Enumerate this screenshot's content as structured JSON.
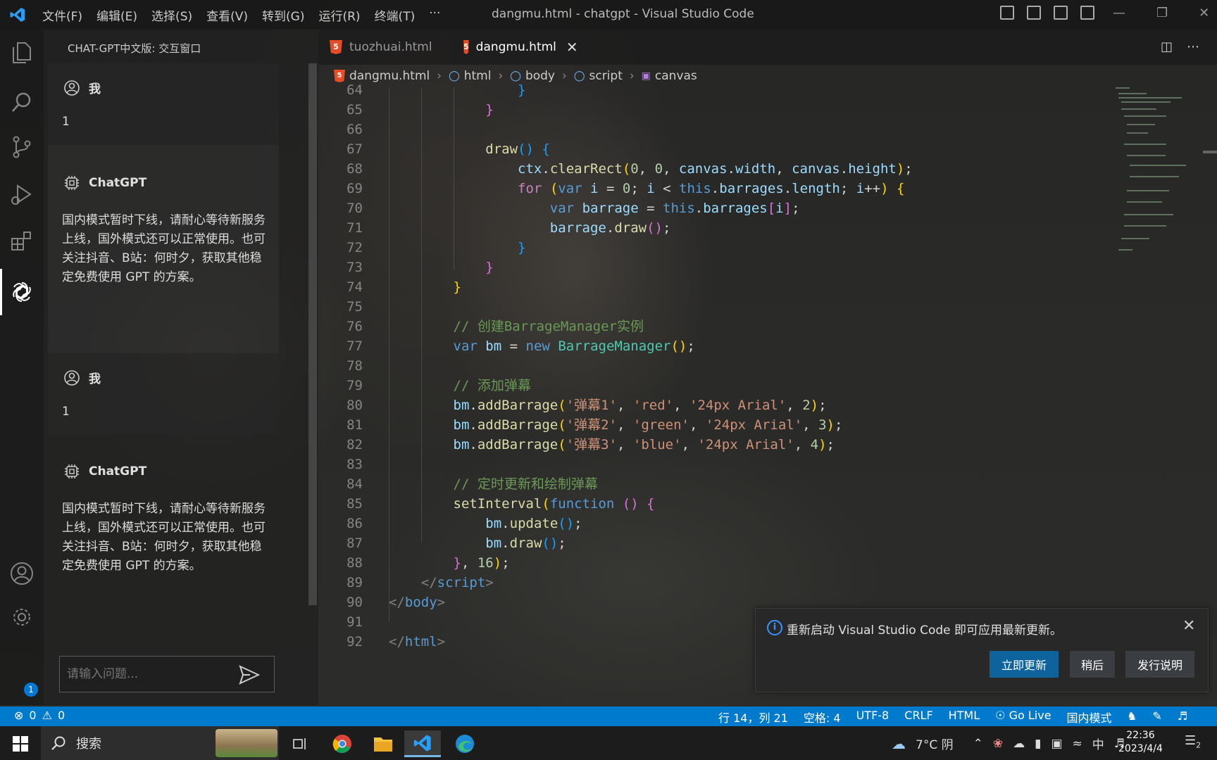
{
  "titlebar": {
    "menu": [
      "文件(F)",
      "编辑(E)",
      "选择(S)",
      "查看(V)",
      "转到(G)",
      "运行(R)",
      "终端(T)",
      "···"
    ],
    "title": "dangmu.html - chatgpt - Visual Studio Code"
  },
  "activitybar": {
    "icons": [
      "explorer-icon",
      "search-icon",
      "source-control-icon",
      "run-debug-icon",
      "extensions-icon",
      "chatgpt-icon",
      "account-icon",
      "settings-gear-icon"
    ],
    "settings_badge": "1"
  },
  "sidepanel": {
    "title": "CHAT-GPT中文版: 交互窗口",
    "messages": [
      {
        "role": "我",
        "text": "1"
      },
      {
        "role": "ChatGPT",
        "text": "国内模式暂时下线，请耐心等待新服务上线，国外模式还可以正常使用。也可关注抖音、B站：何时夕，获取其他稳定免费使用 GPT 的方案。"
      },
      {
        "role": "我",
        "text": "1"
      },
      {
        "role": "ChatGPT",
        "text": "国内模式暂时下线，请耐心等待新服务上线，国外模式还可以正常使用。也可关注抖音、B站：何时夕，获取其他稳定免费使用 GPT 的方案。"
      }
    ],
    "input_placeholder": "请输入问题..."
  },
  "tabs": [
    {
      "label": "tuozhuai.html",
      "active": false
    },
    {
      "label": "dangmu.html",
      "active": true
    }
  ],
  "breadcrumb": [
    "dangmu.html",
    "html",
    "body",
    "script",
    "canvas"
  ],
  "editor": {
    "line_numbers": [
      "64",
      "65",
      "66",
      "67",
      "68",
      "69",
      "70",
      "71",
      "72",
      "73",
      "74",
      "75",
      "76",
      "77",
      "78",
      "79",
      "80",
      "81",
      "82",
      "83",
      "84",
      "85",
      "86",
      "87",
      "88",
      "89",
      "90",
      "91",
      "92"
    ]
  },
  "notification": {
    "message": "重新启动 Visual Studio Code 即可应用最新更新。",
    "buttons": [
      "立即更新",
      "稍后",
      "发行说明"
    ]
  },
  "statusbar": {
    "errors": "0",
    "warnings": "0",
    "position": "行 14，列 21",
    "spaces": "空格: 4",
    "encoding": "UTF-8",
    "eol": "CRLF",
    "language": "HTML",
    "golive": "Go Live",
    "mode": "国内模式"
  },
  "taskbar": {
    "search": "搜索",
    "weather": "7°C 阴",
    "ime": "中",
    "time": "22:36",
    "date": "2023/4/4",
    "notif_count": "2"
  },
  "colors": {
    "accent": "#007acc",
    "primary_button": "#0e639c",
    "html5": "#e44d26"
  }
}
